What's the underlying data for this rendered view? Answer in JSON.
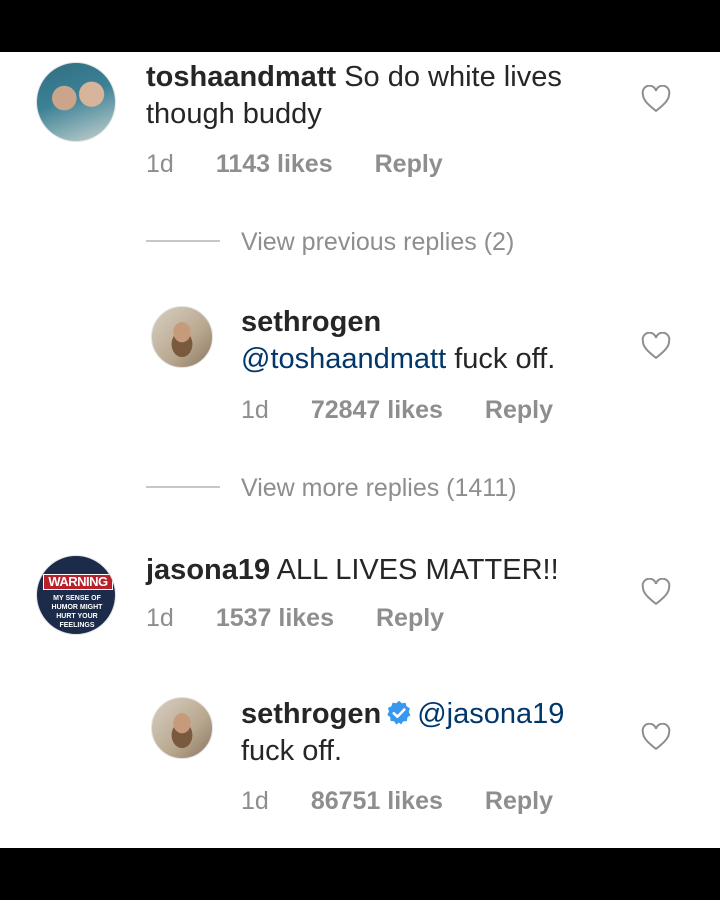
{
  "comments": [
    {
      "avatar": "tosha-avatar",
      "username": "toshaandmatt",
      "text": "So do white lives though buddy",
      "age": "1d",
      "likes": "1143 likes",
      "reply": "Reply"
    },
    {
      "avatar": "seth-avatar",
      "username": "sethrogen",
      "mention": "@toshaandmatt",
      "text": "fuck off.",
      "age": "1d",
      "likes": "72847 likes",
      "reply": "Reply"
    },
    {
      "avatar": "jason-avatar",
      "avatar_text": "WARNING",
      "avatar_subtext": "MY SENSE OF HUMOR MIGHT HURT YOUR FEELINGS",
      "username": "jasona19",
      "text": "ALL LIVES MATTER!!",
      "age": "1d",
      "likes": "1537 likes",
      "reply": "Reply"
    },
    {
      "avatar": "seth-avatar",
      "username": "sethrogen",
      "verified": true,
      "mention": "@jasona19",
      "text": "fuck off.",
      "age": "1d",
      "likes": "86751 likes",
      "reply": "Reply"
    }
  ],
  "view_previous": "View previous replies (2)",
  "view_more": "View more replies (1411)",
  "colors": {
    "mention": "#00376b",
    "muted": "#8e8e8e",
    "text": "#262626",
    "verified": "#3897f0"
  },
  "icons": [
    "heart-icon",
    "verified-badge-icon"
  ]
}
